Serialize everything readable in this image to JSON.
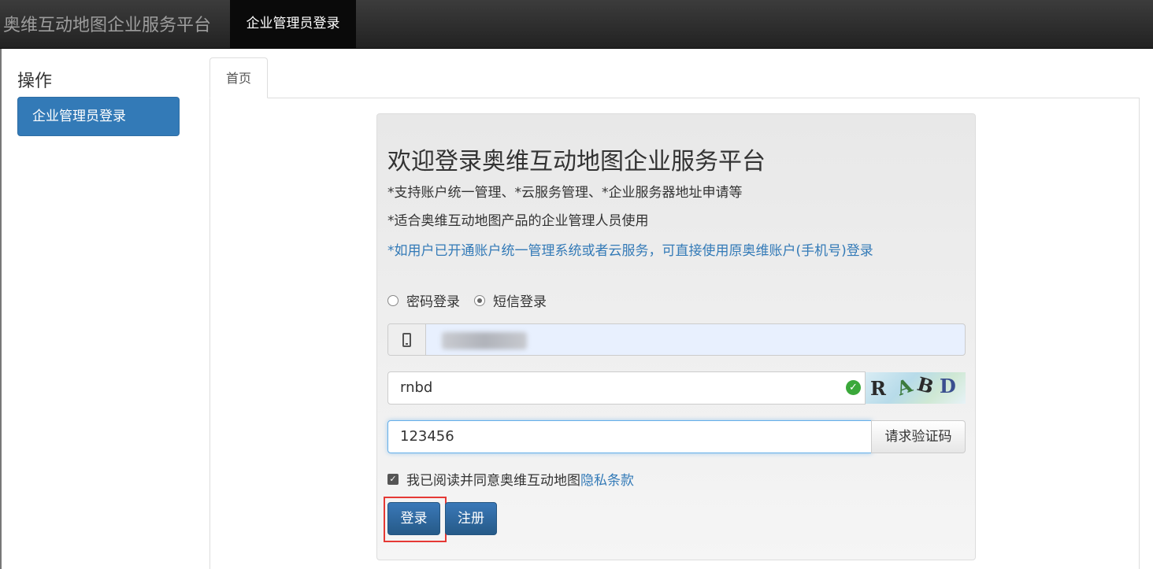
{
  "navbar": {
    "brand": "奥维互动地图企业服务平台",
    "active_item": "企业管理员登录"
  },
  "sidebar": {
    "title": "操作",
    "items": [
      {
        "label": "企业管理员登录"
      }
    ]
  },
  "tabs": [
    {
      "label": "首页"
    }
  ],
  "login": {
    "welcome": "欢迎登录奥维互动地图企业服务平台",
    "features": [
      "*支持账户统一管理、*云服务管理、*企业服务器地址申请等",
      "*适合奥维互动地图产品的企业管理人员使用",
      "*如用户已开通账户统一管理系统或者云服务，可直接使用原奥维账户(手机号)登录"
    ],
    "mode_options": [
      {
        "label": "密码登录",
        "selected": false
      },
      {
        "label": "短信登录",
        "selected": true
      }
    ],
    "captcha_value": "rnbd",
    "captcha_chars": [
      "R",
      "A",
      "B",
      "D"
    ],
    "sms_code_value": "123456",
    "request_code_label": "请求验证码",
    "agree_text": "我已阅读并同意奥维互动地图",
    "privacy_link": "隐私条款",
    "login_label": "登录",
    "register_label": "注册"
  },
  "colors": {
    "primary": "#337ab7",
    "highlight": "#e53935"
  },
  "icons": {
    "phone": "mobile-phone-icon",
    "valid": "check-circle-icon"
  }
}
